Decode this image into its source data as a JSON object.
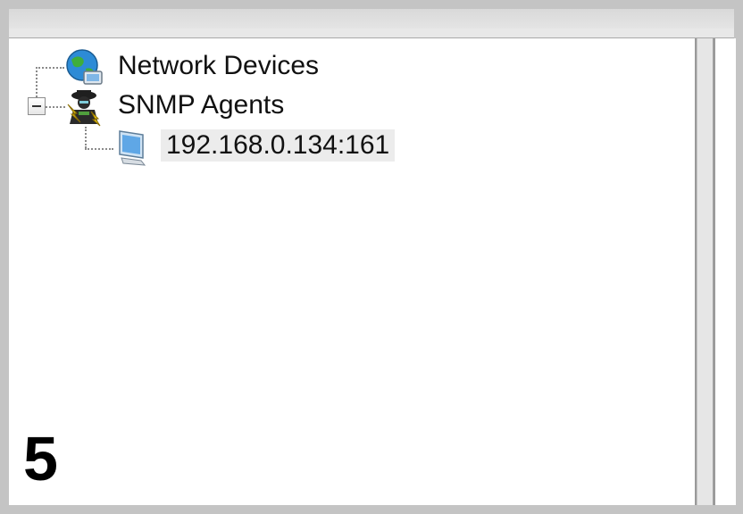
{
  "tree": {
    "nodes": [
      {
        "label": "Network Devices",
        "icon": "globe-network-icon"
      },
      {
        "label": "SNMP Agents",
        "icon": "snmp-agent-icon",
        "expanded": true
      },
      {
        "label": "192.168.0.134:161",
        "icon": "computer-monitor-icon",
        "selected": true
      }
    ]
  },
  "step_number": "5"
}
